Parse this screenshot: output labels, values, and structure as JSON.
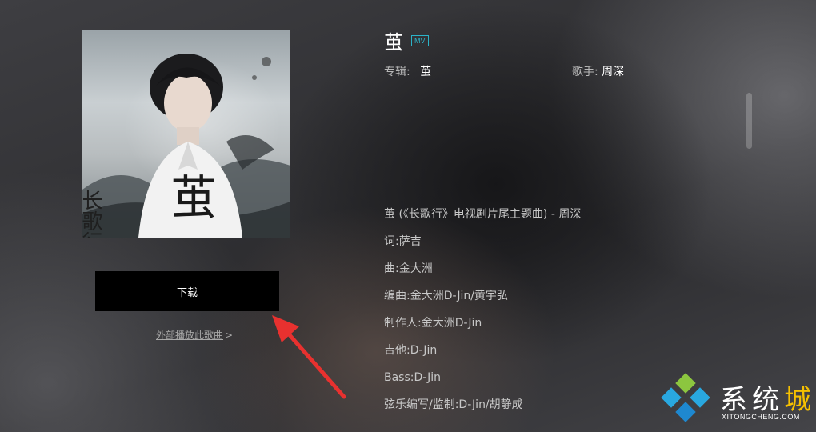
{
  "cover": {
    "alt": "album-cover",
    "art_calligraphy": "茧",
    "art_series": "长歌行"
  },
  "actions": {
    "download_label": "下载",
    "external_play_label": "外部播放此歌曲",
    "external_play_arrow": ">"
  },
  "song": {
    "title": "茧",
    "mv_badge": "MV",
    "album_key": "专辑:",
    "album_value": "茧",
    "artist_key": "歌手:",
    "artist_value": "周深"
  },
  "lyrics": [
    "茧 (《长歌行》电视剧片尾主题曲) - 周深",
    "词:萨吉",
    "曲:金大洲",
    "编曲:金大洲D-Jin/黄宇弘",
    "制作人:金大洲D-Jin",
    "吉他:D-Jin",
    "Bass:D-Jin",
    "弦乐编写/监制:D-Jin/胡静成"
  ],
  "watermark": {
    "text_main": "系统",
    "text_accent": "城",
    "url": "XITONGCHENG.COM"
  },
  "colors": {
    "mv_badge": "#2bb3c8",
    "download_bg": "#000000",
    "annotation_arrow": "#e8312f",
    "watermark_accent": "#f5c000"
  }
}
